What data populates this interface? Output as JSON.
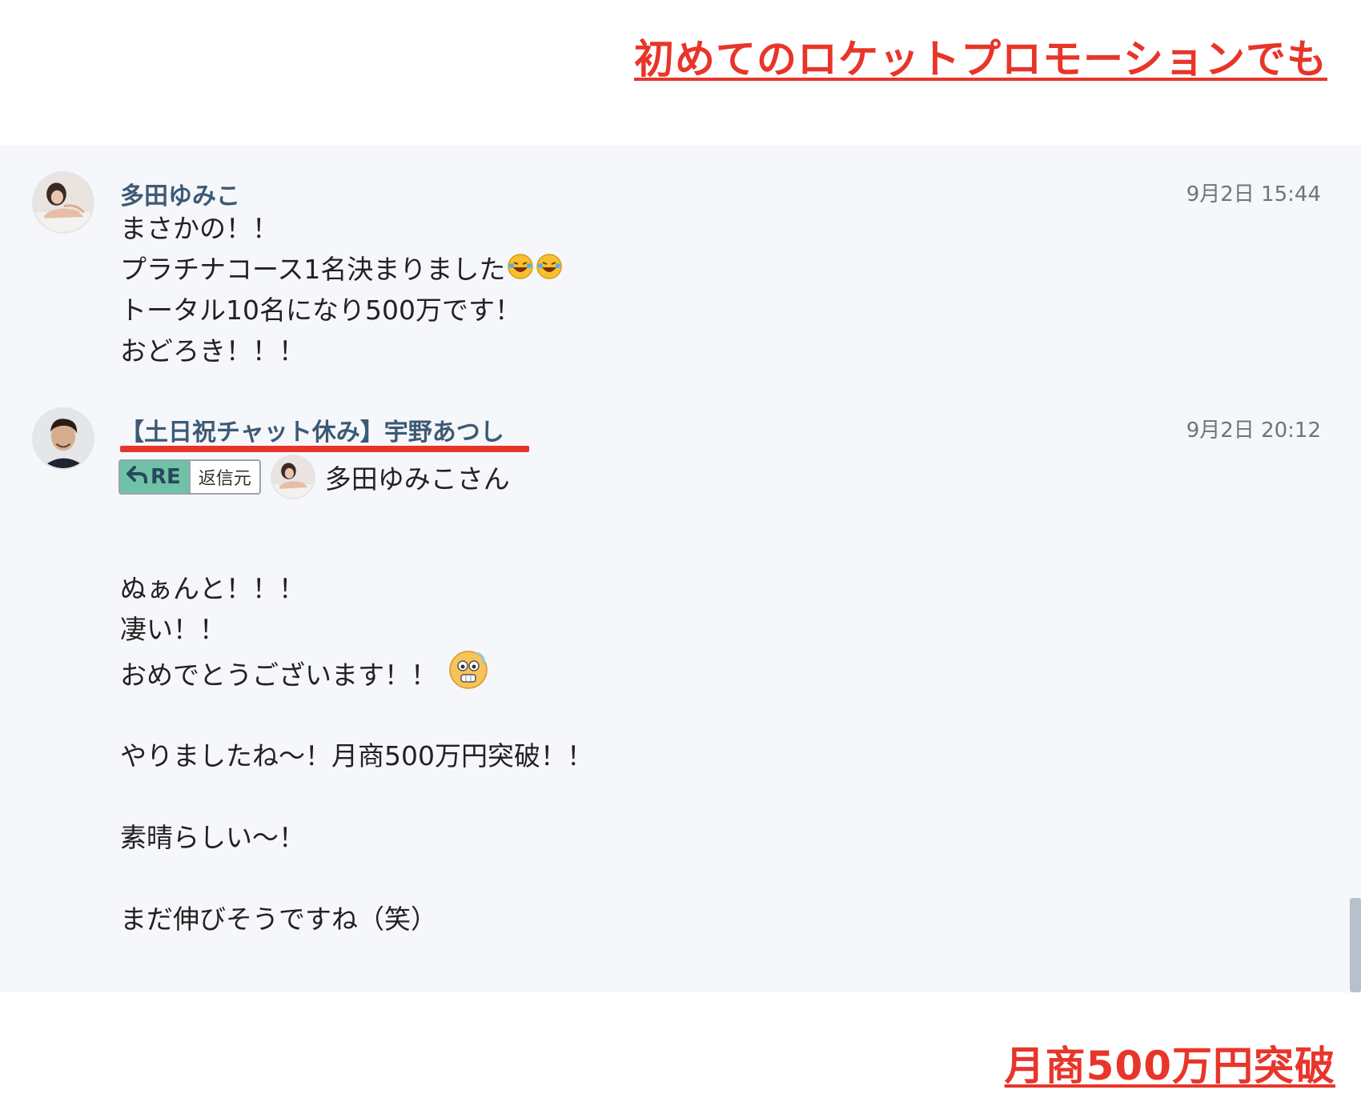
{
  "headline_top": "初めてのロケットプロモーションでも",
  "headline_bottom": "月商500万円突破",
  "messages": [
    {
      "sender": "多田ゆみこ",
      "time": "9月2日 15:44",
      "lines": [
        "まさかの！！",
        "プラチナコース1名決まりました",
        "トータル10名になり500万です！",
        "おどろき！！！"
      ]
    },
    {
      "sender": "【土日祝チャット休み】宇野あつし",
      "time": "9月2日 20:12",
      "reply": {
        "re_label": "RE",
        "source_label": "返信元",
        "target_name": "多田ゆみこさん"
      },
      "lines": [
        "ぬぁんと！！！",
        "凄い！！",
        "おめでとうございます！！",
        "やりましたね〜！月商500万円突破！！",
        "素晴らしい〜！",
        "まだ伸びそうですね（笑）"
      ]
    }
  ],
  "icons": {
    "laugh": "rolling-on-floor-laughing-emoji",
    "surprised": "surprised-face-emoji",
    "reply": "reply-arrow-icon"
  }
}
